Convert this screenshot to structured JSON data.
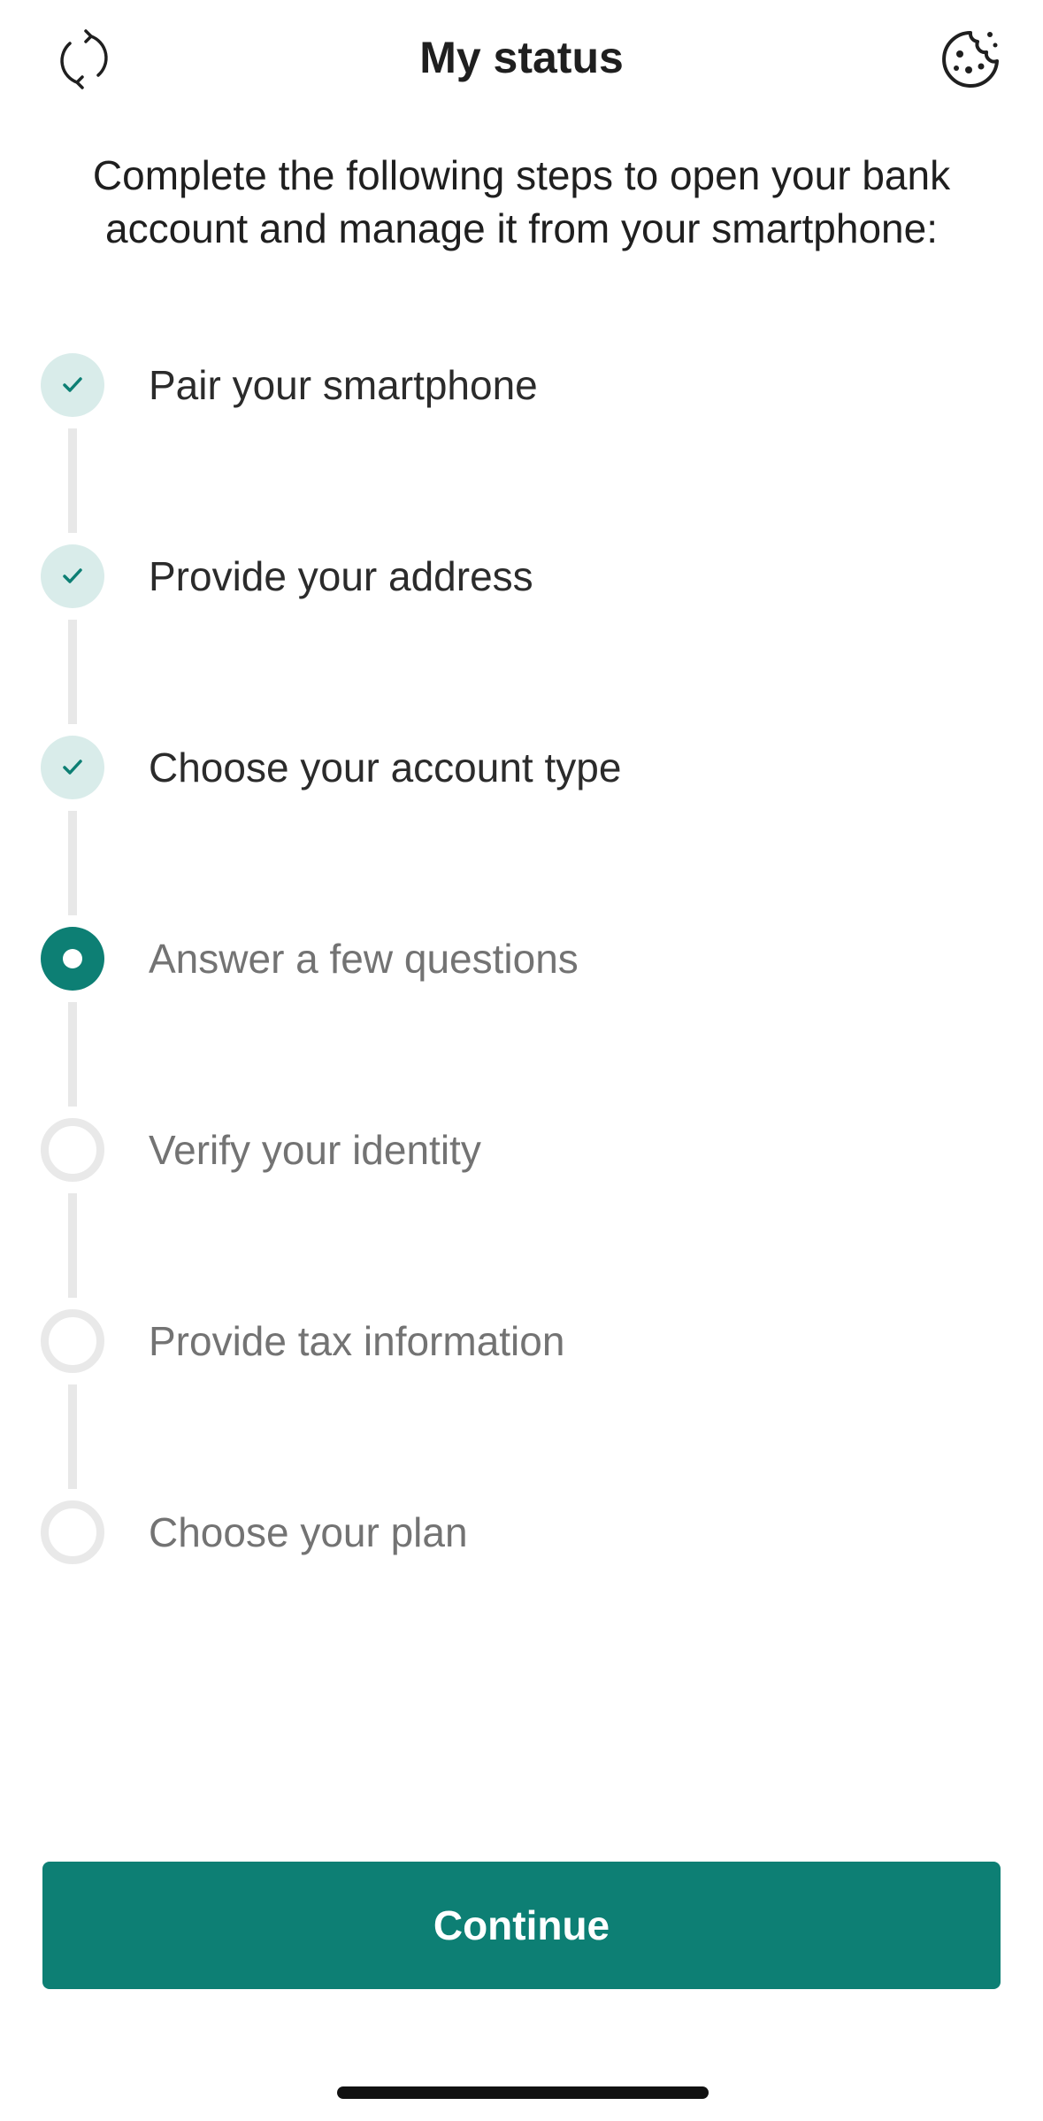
{
  "header": {
    "title": "My status",
    "left_icon": "refresh-icon",
    "right_icon": "cookie-icon"
  },
  "intro": {
    "text": "Complete the following steps to open your bank account and manage it from your smartphone:"
  },
  "steps": [
    {
      "label": "Pair your smartphone",
      "status": "done"
    },
    {
      "label": "Provide your address",
      "status": "done"
    },
    {
      "label": "Choose your account type",
      "status": "done"
    },
    {
      "label": "Answer a few questions",
      "status": "current"
    },
    {
      "label": "Verify your identity",
      "status": "pending"
    },
    {
      "label": "Provide tax information",
      "status": "pending"
    },
    {
      "label": "Choose your plan",
      "status": "pending"
    }
  ],
  "actions": {
    "continue_label": "Continue"
  },
  "colors": {
    "accent": "#0d7f74",
    "done_marker_bg": "#d9ecea",
    "pending_marker_border": "#e9e9e9",
    "muted_text": "#737373"
  }
}
